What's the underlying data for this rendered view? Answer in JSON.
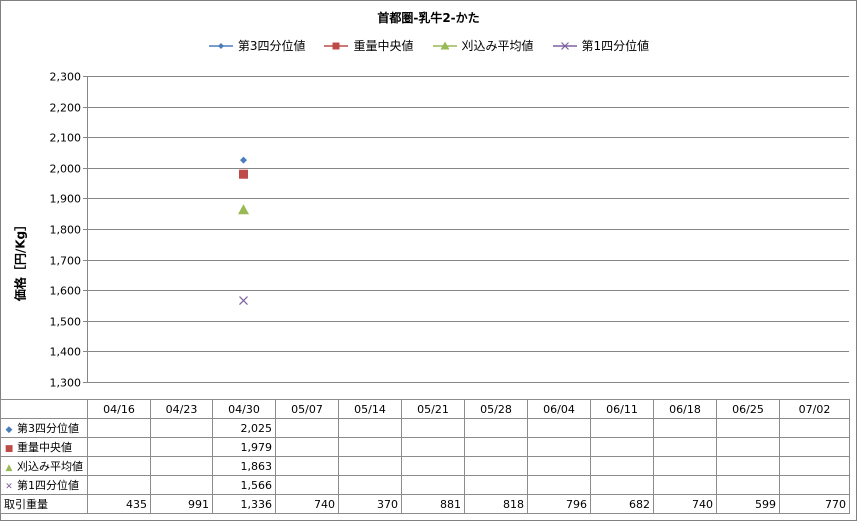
{
  "chart_data": {
    "type": "scatter",
    "title": "首都圏-乳牛2-かた",
    "ylabel": "価格［円/Kg］",
    "ylim": [
      1300,
      2300
    ],
    "y_tick_step": 100,
    "grid": true,
    "legend_position": "top",
    "categories": [
      "04/16",
      "04/23",
      "04/30",
      "05/07",
      "05/14",
      "05/21",
      "05/28",
      "06/04",
      "06/11",
      "06/18",
      "06/25",
      "07/02"
    ],
    "series": [
      {
        "name": "第3四分位値",
        "marker": "diamond",
        "color": "#4a7ebb",
        "values": [
          null,
          null,
          2025,
          null,
          null,
          null,
          null,
          null,
          null,
          null,
          null,
          null
        ]
      },
      {
        "name": "重量中央値",
        "marker": "square",
        "color": "#be4b48",
        "values": [
          null,
          null,
          1979,
          null,
          null,
          null,
          null,
          null,
          null,
          null,
          null,
          null
        ]
      },
      {
        "name": "刈込み平均値",
        "marker": "triangle",
        "color": "#98b954",
        "values": [
          null,
          null,
          1863,
          null,
          null,
          null,
          null,
          null,
          null,
          null,
          null,
          null
        ]
      },
      {
        "name": "第1四分位値",
        "marker": "x",
        "color": "#7d60a0",
        "values": [
          null,
          null,
          1566,
          null,
          null,
          null,
          null,
          null,
          null,
          null,
          null,
          null
        ]
      }
    ],
    "table_rows": [
      {
        "label": "第3四分位値",
        "marker": "diamond",
        "color": "#4a7ebb",
        "cells": [
          "",
          "",
          "2,025",
          "",
          "",
          "",
          "",
          "",
          "",
          "",
          "",
          ""
        ]
      },
      {
        "label": "重量中央値",
        "marker": "square",
        "color": "#be4b48",
        "cells": [
          "",
          "",
          "1,979",
          "",
          "",
          "",
          "",
          "",
          "",
          "",
          "",
          ""
        ]
      },
      {
        "label": "刈込み平均値",
        "marker": "triangle",
        "color": "#98b954",
        "cells": [
          "",
          "",
          "1,863",
          "",
          "",
          "",
          "",
          "",
          "",
          "",
          "",
          ""
        ]
      },
      {
        "label": "第1四分位値",
        "marker": "x",
        "color": "#7d60a0",
        "cells": [
          "",
          "",
          "1,566",
          "",
          "",
          "",
          "",
          "",
          "",
          "",
          "",
          ""
        ]
      },
      {
        "label": "取引重量",
        "marker": "",
        "color": "",
        "cells": [
          "435",
          "991",
          "1,336",
          "740",
          "370",
          "881",
          "818",
          "796",
          "682",
          "740",
          "599",
          "770"
        ]
      }
    ]
  }
}
